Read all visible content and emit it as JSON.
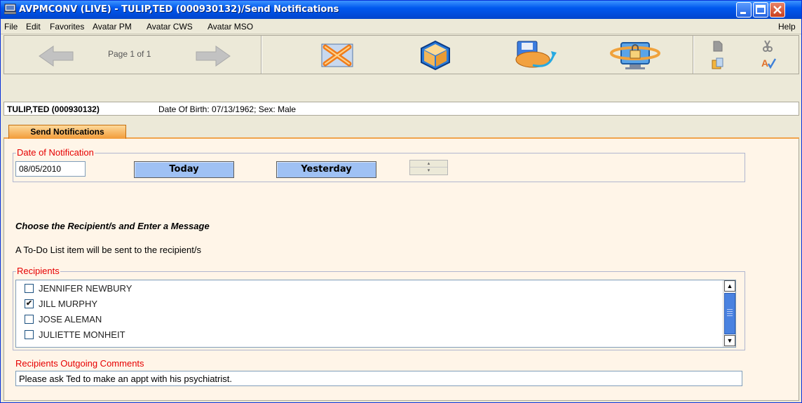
{
  "window": {
    "title": "AVPMCONV (LIVE) - TULIP,TED (000930132)/Send Notifications"
  },
  "menu": {
    "items": [
      "File",
      "Edit",
      "Favorites",
      "Avatar PM",
      "Avatar CWS",
      "Avatar MSO"
    ],
    "help": "Help"
  },
  "toolbar": {
    "page_label": "Page 1 of 1",
    "icons": [
      "back-arrow-icon",
      "forward-arrow-icon",
      "close-form-icon",
      "package-icon",
      "submit-disk-icon",
      "lock-monitor-icon",
      "copy-icon",
      "cut-icon",
      "paste-icon",
      "spellcheck-icon"
    ]
  },
  "banner": {
    "patient": "TULIP,TED (000930132)",
    "details": "Date Of Birth: 07/13/1962; Sex: Male"
  },
  "tab": {
    "label": "Send Notifications"
  },
  "form": {
    "date_legend": "Date of Notification",
    "date_value": "08/05/2010",
    "today_label": "Today",
    "yesterday_label": "Yesterday",
    "heading": "Choose the Recipient/s and Enter a Message",
    "subtext": "A To-Do List item will be sent to the recipient/s",
    "recipients_legend": "Recipients",
    "recipients": [
      {
        "name": "JENNIFER NEWBURY",
        "checked": false,
        "mark": ""
      },
      {
        "name": "JILL MURPHY",
        "checked": true,
        "mark": "✔"
      },
      {
        "name": "JOSE ALEMAN",
        "checked": false,
        "mark": ""
      },
      {
        "name": "JULIETTE MONHEIT",
        "checked": false,
        "mark": ""
      }
    ],
    "comments_label": "Recipients Outgoing Comments",
    "comments_value": "Please ask Ted to make an appt with his psychiatrist."
  },
  "colors": {
    "title_blue": "#0058ee",
    "legend_red": "#e60000",
    "button_blue": "#9fc1f4",
    "tab_orange": "#f29b38",
    "content_bg": "#fff5e8"
  }
}
